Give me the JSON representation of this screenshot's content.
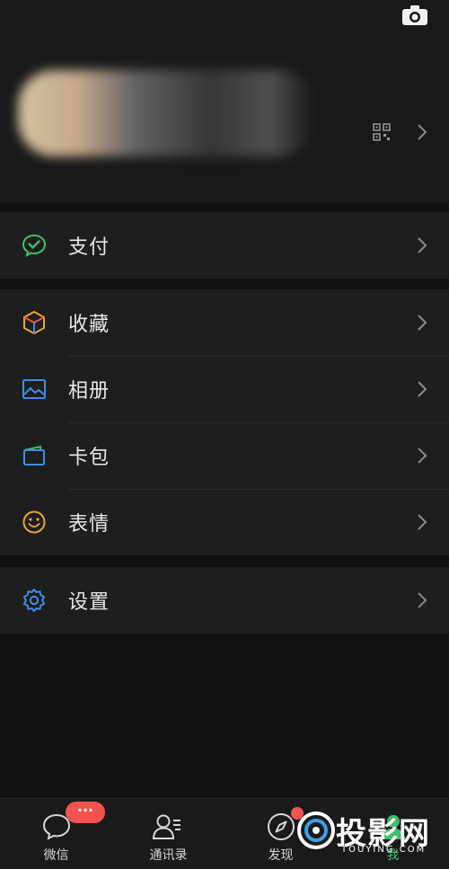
{
  "profile": {
    "camera_icon": "camera-icon",
    "qr_icon": "qr-code-icon",
    "chevron_icon": "chevron-right-icon"
  },
  "menu": {
    "group1": [
      {
        "label": "支付",
        "icon": "wechat-pay-icon"
      }
    ],
    "group2": [
      {
        "label": "收藏",
        "icon": "cube-favorites-icon"
      },
      {
        "label": "相册",
        "icon": "photo-album-icon"
      },
      {
        "label": "卡包",
        "icon": "card-wallet-icon"
      },
      {
        "label": "表情",
        "icon": "smiley-face-icon"
      }
    ],
    "group3": [
      {
        "label": "设置",
        "icon": "gear-icon"
      }
    ]
  },
  "tabbar": {
    "tabs": [
      {
        "label": "微信",
        "icon": "chat-bubble-icon",
        "badge": "···"
      },
      {
        "label": "通讯录",
        "icon": "contacts-icon"
      },
      {
        "label": "发现",
        "icon": "compass-icon"
      },
      {
        "label": "我",
        "icon": "person-icon"
      }
    ]
  },
  "watermark": {
    "text": "投影网",
    "sub": "TOUYING.COM"
  },
  "colors": {
    "background": "#111111",
    "panel": "#1e1e1e",
    "badge": "#f2534c",
    "pay_green": "#3fbf6a",
    "accent_blue": "#3d8ee8",
    "amber": "#e6a43b"
  }
}
